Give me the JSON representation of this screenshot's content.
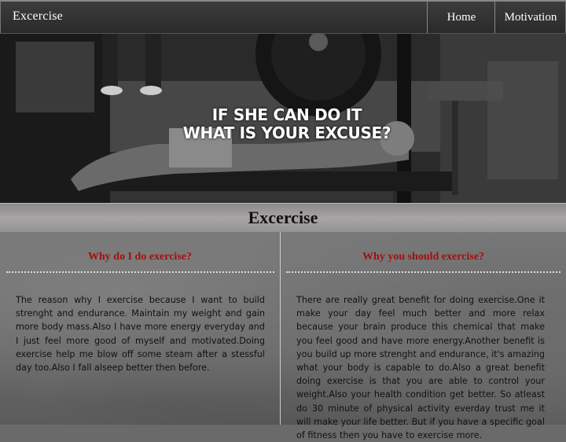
{
  "navbar": {
    "brand": "Excercise",
    "items": [
      {
        "label": "Home"
      },
      {
        "label": "Motivation"
      }
    ]
  },
  "hero": {
    "line1": "IF SHE CAN DO IT",
    "line2": "WHAT IS YOUR EXCUSE?"
  },
  "page": {
    "title": "Excercise"
  },
  "columns": [
    {
      "heading": "Why do I do exercise?",
      "body": "The reason why I exercise because I want to build strenght and endurance. Maintain my weight and gain more body mass.Also I have more energy everyday and I just feel more good of myself and motivated.Doing exercise help me blow off some steam after a stessful day too.Also I fall alseep better then before."
    },
    {
      "heading": "Why you should exercise?",
      "body": "There are really great benefit for doing exercise.One it make your day feel much better and more relax because your brain produce this chemical that make you feel good and have more energy.Another benefit is you build up more strenght and endurance, it's amazing what your body is capable to do.Also a great benefit doing exercise is that you are able to control your weight.Also your health condition get better. So atleast do 30 minute of physical activity everday trust me it will make your life better. But if you have a specific goal of fitness then you have to exercise more."
    }
  ],
  "colors": {
    "navbar_bg": "#2f2f2f",
    "heading_red": "#a30f0f",
    "title_bar": "#a7a4a5"
  }
}
